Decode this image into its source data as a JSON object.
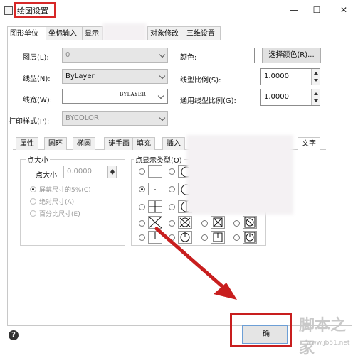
{
  "window": {
    "title": "绘图设置",
    "minimize_glyph": "—",
    "maximize_glyph": "☐",
    "close_glyph": "✕"
  },
  "tabs": [
    {
      "label": "图形单位"
    },
    {
      "label": "坐标输入"
    },
    {
      "label": "显示"
    },
    {
      "label": "对象修改"
    },
    {
      "label": "三维设置"
    }
  ],
  "form": {
    "layer_label": "图层(L):",
    "layer_value": "0",
    "color_label": "颜色:",
    "choose_color_button": "选择颜色(R)...",
    "linetype_label": "线型(N):",
    "linetype_value": "ByLayer",
    "linetype_scale_label": "线型比例(S):",
    "linetype_scale_value": "1.0000",
    "lineweight_label": "线宽(W):",
    "lineweight_value": "BYLAYER",
    "global_scale_label": "通用线型比例(G):",
    "global_scale_value": "1.0000",
    "plot_style_label": "打印样式(P):",
    "plot_style_value": "BYCOLOR"
  },
  "subtabs": [
    {
      "label": "属性"
    },
    {
      "label": "圆环"
    },
    {
      "label": "椭圆"
    },
    {
      "label": "徒手画"
    },
    {
      "label": "填充"
    },
    {
      "label": "插入"
    },
    {
      "label": "文字"
    }
  ],
  "point_size": {
    "group_title": "点大小",
    "size_label": "点大小",
    "size_value": "0.0000",
    "opt_screen": "屏幕尺寸的5%(C)",
    "opt_absolute": "绝对尺寸(A)",
    "opt_percent": "百分比尺寸(E)"
  },
  "point_style": {
    "group_title": "点显示类型(O)",
    "selected_index": 1
  },
  "footer": {
    "help_glyph": "?",
    "ok_button": "确",
    "watermark": "脚本之家",
    "watermark_sub": "www.jb51.net"
  },
  "colors": {
    "highlight_red": "#d62828",
    "arrow_red": "#c81e1e"
  }
}
